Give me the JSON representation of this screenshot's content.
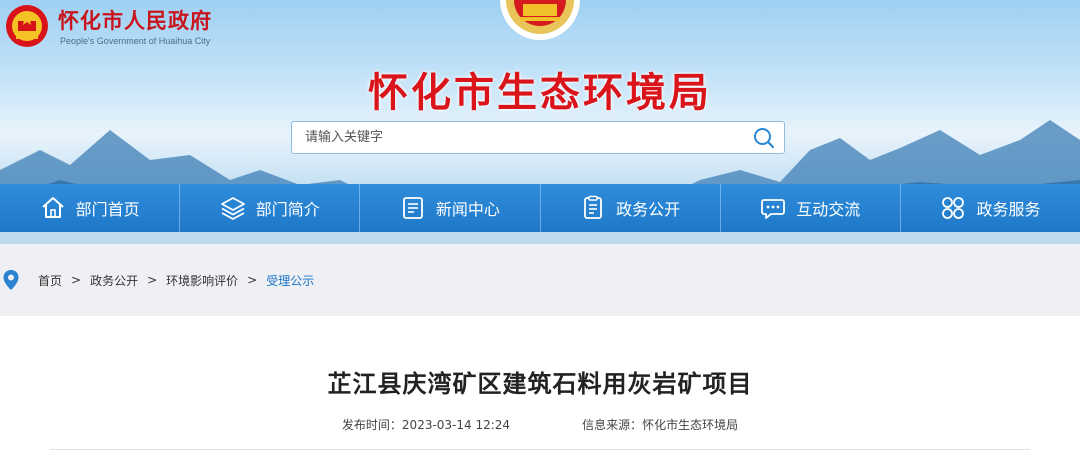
{
  "header": {
    "gov_name": "怀化市人民政府",
    "gov_name_en": "People's Government of Huaihua City",
    "site_title": "怀化市生态环境局"
  },
  "search": {
    "placeholder": "请输入关键字",
    "value": ""
  },
  "nav": {
    "items": [
      {
        "label": "部门首页",
        "icon": "home-icon"
      },
      {
        "label": "部门简介",
        "icon": "layers-icon"
      },
      {
        "label": "新闻中心",
        "icon": "document-icon"
      },
      {
        "label": "政务公开",
        "icon": "list-icon"
      },
      {
        "label": "互动交流",
        "icon": "chat-icon"
      },
      {
        "label": "政务服务",
        "icon": "grid-icon"
      }
    ]
  },
  "breadcrumb": {
    "items": [
      "首页",
      "政务公开",
      "环境影响评价",
      "受理公示"
    ],
    "separator": ">"
  },
  "article": {
    "title": "芷江县庆湾矿区建筑石料用灰岩矿项目",
    "publish_label": "发布时间：",
    "publish_time": "2023-03-14 12:24",
    "source_label": "信息来源：",
    "source": "怀化市生态环境局"
  },
  "colors": {
    "brand_red": "#d9141a",
    "nav_blue": "#1f78c8",
    "link_blue": "#1a73c8"
  }
}
